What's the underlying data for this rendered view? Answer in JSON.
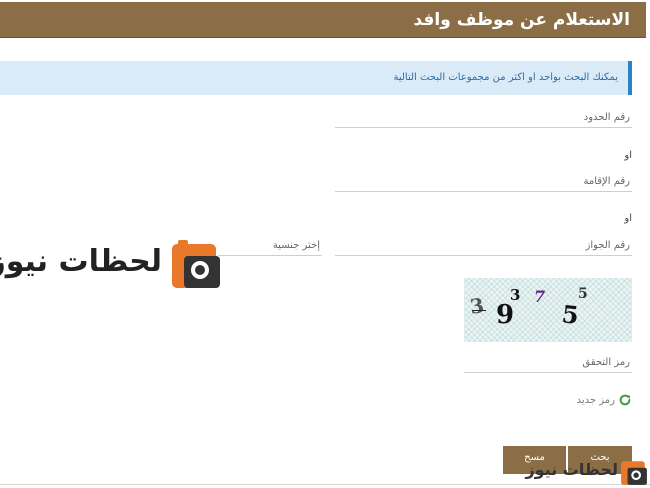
{
  "header": {
    "title": "الاستعلام عن موظف وافد"
  },
  "info": {
    "message": "يمكنك البحث بواحد او اكثر من مجموعات البحث التالية"
  },
  "form": {
    "border_number_placeholder": "رقم الحدود",
    "or_label_1": "او",
    "iqama_placeholder": "رقم الإقامة",
    "or_label_2": "او",
    "passport_placeholder": "رقم الجواز",
    "nationality_placeholder": "إختر جنسية",
    "captcha_chars": [
      "3",
      "9",
      "3",
      "7",
      "5",
      "5"
    ],
    "captcha_code_placeholder": "رمز التحقق",
    "new_code_label": "رمز جديد"
  },
  "buttons": {
    "search_label": "بحث",
    "clear_label": "مسح"
  },
  "watermark": {
    "text": "لحظات نيوز"
  },
  "colors": {
    "header_bg": "#8b6e45",
    "info_bg": "#dbeaf7",
    "info_accent": "#2a84c9",
    "refresh_green": "#3a9a3a",
    "logo_orange": "#e8792b"
  }
}
